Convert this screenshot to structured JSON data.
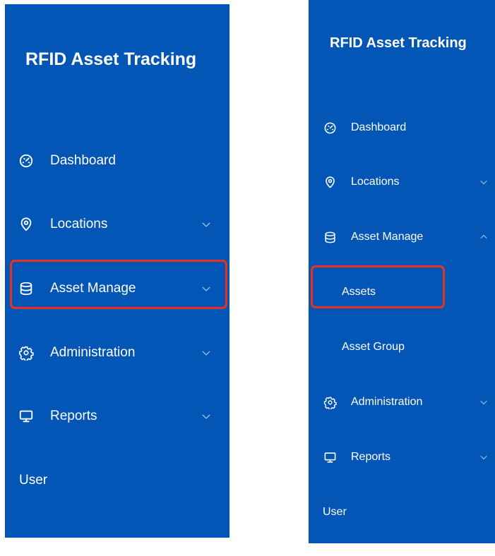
{
  "left_panel": {
    "title": "RFID Asset Tracking",
    "items": [
      {
        "label": "Dashboard",
        "icon": "dashboard-gauge-icon"
      },
      {
        "label": "Locations",
        "icon": "location-pin-icon",
        "expanded": false
      },
      {
        "label": "Asset Manage",
        "icon": "database-icon",
        "expanded": false,
        "highlighted": true
      },
      {
        "label": "Administration",
        "icon": "gear-icon",
        "expanded": false
      },
      {
        "label": "Reports",
        "icon": "monitor-icon",
        "expanded": false
      },
      {
        "label": "User"
      }
    ]
  },
  "right_panel": {
    "title": "RFID Asset Tracking",
    "items": [
      {
        "label": "Dashboard",
        "icon": "dashboard-gauge-icon"
      },
      {
        "label": "Locations",
        "icon": "location-pin-icon",
        "expanded": false
      },
      {
        "label": "Asset Manage",
        "icon": "database-icon",
        "expanded": true
      },
      {
        "label": "Assets",
        "highlighted": true
      },
      {
        "label": "Asset Group"
      },
      {
        "label": "Administration",
        "icon": "gear-icon",
        "expanded": false
      },
      {
        "label": "Reports",
        "icon": "monitor-icon",
        "expanded": false
      },
      {
        "label": "User"
      }
    ]
  },
  "colors": {
    "sidebar_background": "#0356b5",
    "text": "#ffffff",
    "chevron": "#9fc1ec",
    "highlight_border": "#e8321e"
  }
}
